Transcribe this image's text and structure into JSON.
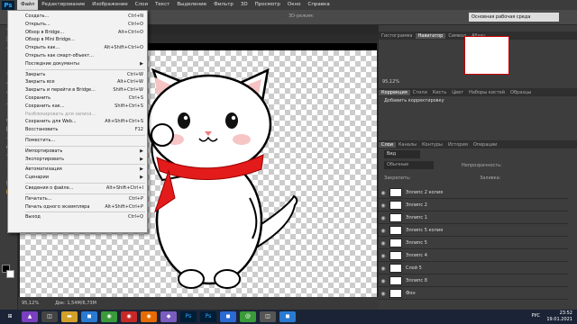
{
  "menubar": {
    "logo": "Ps",
    "items": [
      "Файл",
      "Редактирование",
      "Изображение",
      "Слои",
      "Текст",
      "Выделение",
      "Фильтр",
      "3D",
      "Просмотр",
      "Окно",
      "Справка"
    ]
  },
  "options": {
    "mode_3d": "3D-режим:",
    "workspace": "Основная рабочая среда"
  },
  "file_menu": {
    "groups": [
      [
        {
          "label": "Создать...",
          "shortcut": "Ctrl+N"
        },
        {
          "label": "Открыть...",
          "shortcut": "Ctrl+O"
        },
        {
          "label": "Обзор в Bridge...",
          "shortcut": "Alt+Ctrl+O"
        },
        {
          "label": "Обзор в Mini Bridge...",
          "shortcut": ""
        },
        {
          "label": "Открыть как...",
          "shortcut": "Alt+Shift+Ctrl+O"
        },
        {
          "label": "Открыть как смарт-объект...",
          "shortcut": ""
        },
        {
          "label": "Последние документы",
          "shortcut": "▶"
        }
      ],
      [
        {
          "label": "Закрыть",
          "shortcut": "Ctrl+W"
        },
        {
          "label": "Закрыть все",
          "shortcut": "Alt+Ctrl+W"
        },
        {
          "label": "Закрыть и перейти в Bridge...",
          "shortcut": "Shift+Ctrl+W"
        },
        {
          "label": "Сохранить",
          "shortcut": "Ctrl+S"
        },
        {
          "label": "Сохранить как...",
          "shortcut": "Shift+Ctrl+S"
        },
        {
          "label": "Разблокировать для записи...",
          "shortcut": "",
          "disabled": true
        },
        {
          "label": "Сохранить для Web...",
          "shortcut": "Alt+Shift+Ctrl+S"
        },
        {
          "label": "Восстановить",
          "shortcut": "F12"
        }
      ],
      [
        {
          "label": "Поместить...",
          "shortcut": ""
        }
      ],
      [
        {
          "label": "Импортировать",
          "shortcut": "▶"
        },
        {
          "label": "Экспортировать",
          "shortcut": "▶"
        }
      ],
      [
        {
          "label": "Автоматизация",
          "shortcut": "▶"
        },
        {
          "label": "Сценарии",
          "shortcut": "▶"
        }
      ],
      [
        {
          "label": "Сведения о файле...",
          "shortcut": "Alt+Shift+Ctrl+I"
        }
      ],
      [
        {
          "label": "Печатать...",
          "shortcut": "Ctrl+P"
        },
        {
          "label": "Печать одного экземпляра",
          "shortcut": "Alt+Shift+Ctrl+P"
        }
      ],
      [
        {
          "label": "Выход",
          "shortcut": "Ctrl+Q"
        }
      ]
    ]
  },
  "status": {
    "zoom": "95,12%",
    "doc": "Док: 1,54M/6,73M"
  },
  "panels": {
    "top_tabs": [
      "Гистограмма",
      "Навигатор",
      "Символ",
      "Абзац"
    ],
    "navigator_zoom": "95,12%",
    "adjust_tabs": [
      "Коррекция",
      "Стили",
      "Кисть",
      "Цвет",
      "Наборы кистей",
      "Образцы"
    ],
    "adjust_hint": "Добавить корректировку",
    "layer_tabs": [
      "Слои",
      "Каналы",
      "Контуры",
      "История",
      "Операции"
    ],
    "kind": "Вид",
    "blend": "Обычные",
    "opacity_label": "Непрозрачность:",
    "lock_label": "Закрепить:",
    "fill_label": "Заливка:",
    "layers": [
      "Эллипс 2 копия",
      "Эллипс 2",
      "Эллипс 1",
      "Эллипс 5 копия",
      "Эллипс 5",
      "Эллипс 4",
      "Слой 5",
      "Эллипс 8",
      "Фон"
    ]
  },
  "clock": {
    "time": "23:52",
    "date": "19.01.2021",
    "lang": "РУС"
  }
}
